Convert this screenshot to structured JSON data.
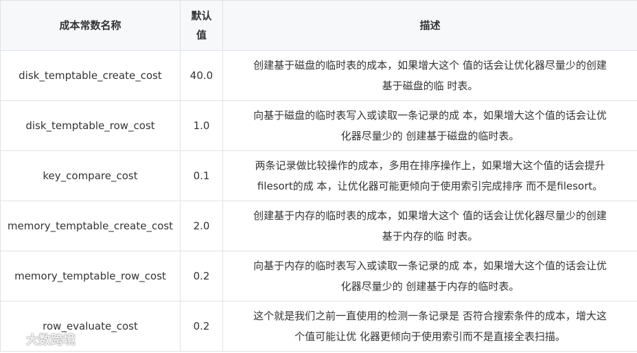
{
  "table": {
    "headers": {
      "name": "成本常数名称",
      "default_line1": "默认",
      "default_line2": "值",
      "description": "描述"
    },
    "rows": [
      {
        "name": "disk_temptable_create_cost",
        "value": "40.0",
        "desc_line1": "创建基于磁盘的临时表的成本，如果增大这个 值的话会让优化器尽量少的创建",
        "desc_line2": "基于磁盘的临 时表。"
      },
      {
        "name": "disk_temptable_row_cost",
        "value": "1.0",
        "desc_line1": "向基于磁盘的临时表写入或读取一条记录的成 本，如果增大这个值的话会让优",
        "desc_line2": "化器尽量少的 创建基于磁盘的临时表。"
      },
      {
        "name": "key_compare_cost",
        "value": "0.1",
        "desc_line1": "两条记录做比较操作的成本，多用在排序操作上，如果增大这个值的话会提升",
        "desc_line2": "filesort的成 本，让优化器可能更倾向于使用索引完成排序 而不是filesort。"
      },
      {
        "name": "memory_temptable_create_cost",
        "value": "2.0",
        "desc_line1": "创建基于内存的临时表的成本，如果增大这个 值的话会让优化器尽量少的创建",
        "desc_line2": "基于内存的临 时表。"
      },
      {
        "name": "memory_temptable_row_cost",
        "value": "0.2",
        "desc_line1": "向基于内存的临时表写入或读取一条记录的成 本，如果增大这个值的话会让优",
        "desc_line2": "化器尽量少的 创建基于内存的临时表。"
      },
      {
        "name": "row_evaluate_cost",
        "value": "0.2",
        "desc_line1": "这个就是我们之前一直使用的检测一条记录是 否符合搜索条件的成本，增大这",
        "desc_line2": "个值可能让优 化器更倾向于使用索引而不是直接全表扫描。"
      }
    ]
  },
  "watermark": {
    "text": "大数跨境",
    "icon": "logo-icon"
  }
}
